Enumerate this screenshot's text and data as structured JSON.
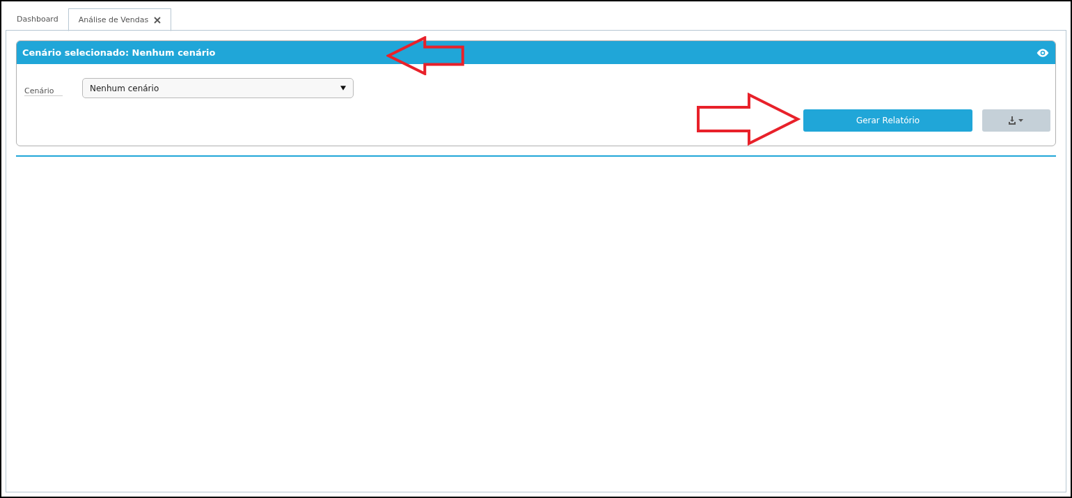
{
  "tabs": [
    {
      "label": "Dashboard",
      "selected": false,
      "closable": false
    },
    {
      "label": "Análise de Vendas",
      "selected": true,
      "closable": true
    }
  ],
  "panel": {
    "title": "Cenário selecionado: Nenhum cenário",
    "field": {
      "label": "Cenário",
      "value": "Nenhum cenário"
    },
    "buttons": [
      {
        "kind": "text",
        "label": "Gerar Relatório",
        "disabled": false
      },
      {
        "kind": "download",
        "disabled": true
      }
    ]
  },
  "annotations": [
    {
      "kind": "arrow-left"
    },
    {
      "kind": "arrow-right"
    }
  ]
}
